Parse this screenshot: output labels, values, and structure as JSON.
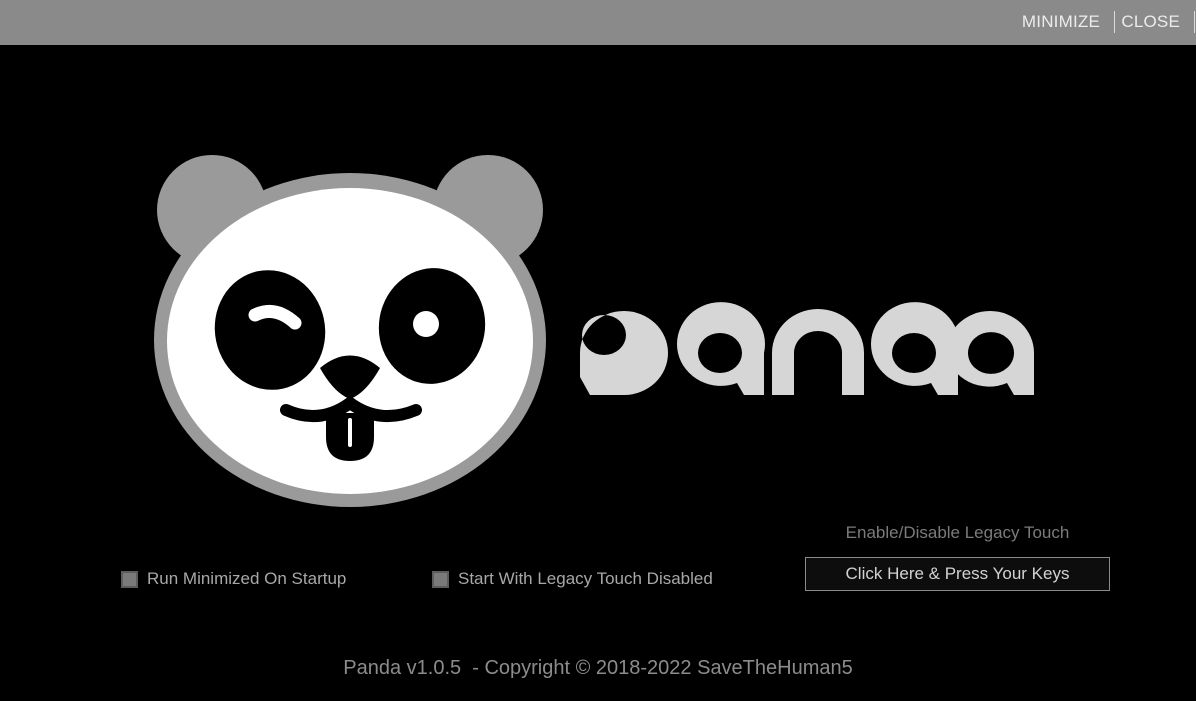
{
  "titlebar": {
    "minimize_label": "MINIMIZE",
    "close_label": "CLOSE"
  },
  "logo": {
    "wordmark": "panda",
    "colors": {
      "face_outline": "#9a9a9a",
      "face": "#ffffff",
      "features": "#000000",
      "wordmark": "#d6d6d6"
    }
  },
  "options": {
    "run_minimized": {
      "label": "Run Minimized On Startup",
      "checked": false
    },
    "legacy_disabled": {
      "label": "Start With Legacy Touch Disabled",
      "checked": false
    }
  },
  "legacy_touch": {
    "title": "Enable/Disable Legacy Touch",
    "button_label": "Click Here & Press Your Keys"
  },
  "footer": {
    "text": "Panda v1.0.5  - Copyright © 2018-2022 SaveTheHuman5"
  }
}
